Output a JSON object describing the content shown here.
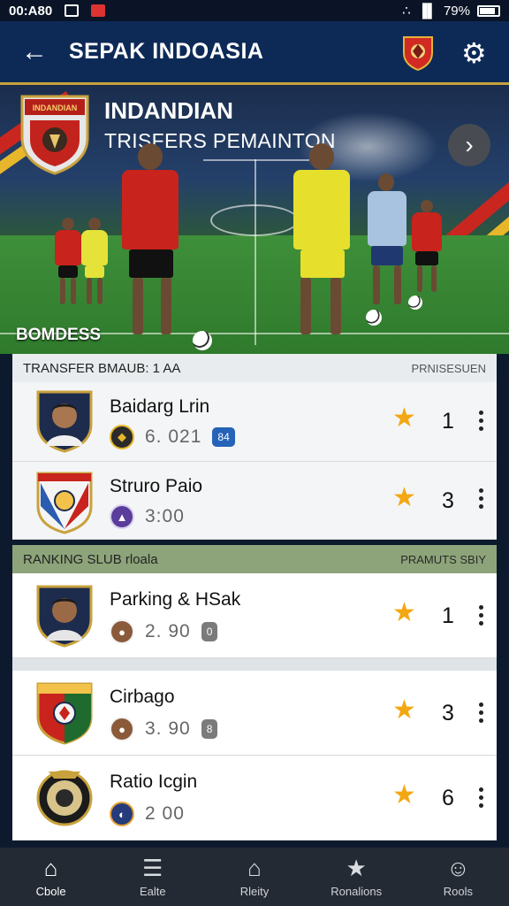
{
  "status_bar": {
    "time": "00:A80",
    "battery": "79%"
  },
  "app_bar": {
    "title": "SEPAK  INDOASIA"
  },
  "hero": {
    "title": "INDANDIAN",
    "subtitle": "TRISFERS PEMAINTON",
    "badge_text": "INDANDIAN",
    "label": "BOMDESS"
  },
  "transfer_section": {
    "header_left": "TRANSFER BMAUB: 1 AA",
    "header_right": "PRNISESUEN",
    "items": [
      {
        "name": "Baidarg Lrin",
        "value": "6. 021",
        "tag": "84",
        "rank": "1"
      },
      {
        "name": "Struro Paio",
        "value": "3:00",
        "tag": "",
        "rank": "3"
      }
    ]
  },
  "ranking_section": {
    "header_left": "RANKING  SLUB rloala",
    "header_right": "PRAMUTS SBIY",
    "items": [
      {
        "name": "Parking & HSak",
        "value": "2. 90",
        "tag": "0",
        "rank": "1"
      },
      {
        "name": "Cirbago",
        "value": "3. 90",
        "tag": "8",
        "rank": "3"
      },
      {
        "name": "Ratio Icgin",
        "value": "2 00",
        "tag": "",
        "rank": "6"
      }
    ]
  },
  "bottom_nav": [
    {
      "label": "Cbole",
      "icon": "home-icon"
    },
    {
      "label": "Ealte",
      "icon": "news-icon"
    },
    {
      "label": "Rleity",
      "icon": "stadium-icon"
    },
    {
      "label": "Ronalions",
      "icon": "star-icon"
    },
    {
      "label": "Rools",
      "icon": "profile-icon"
    }
  ],
  "colors": {
    "app_bar": "#0d2a57",
    "accent_gold": "#c8a23d",
    "star": "#f3a712",
    "section_green": "#8da47a",
    "nav_bg": "#242a33"
  }
}
